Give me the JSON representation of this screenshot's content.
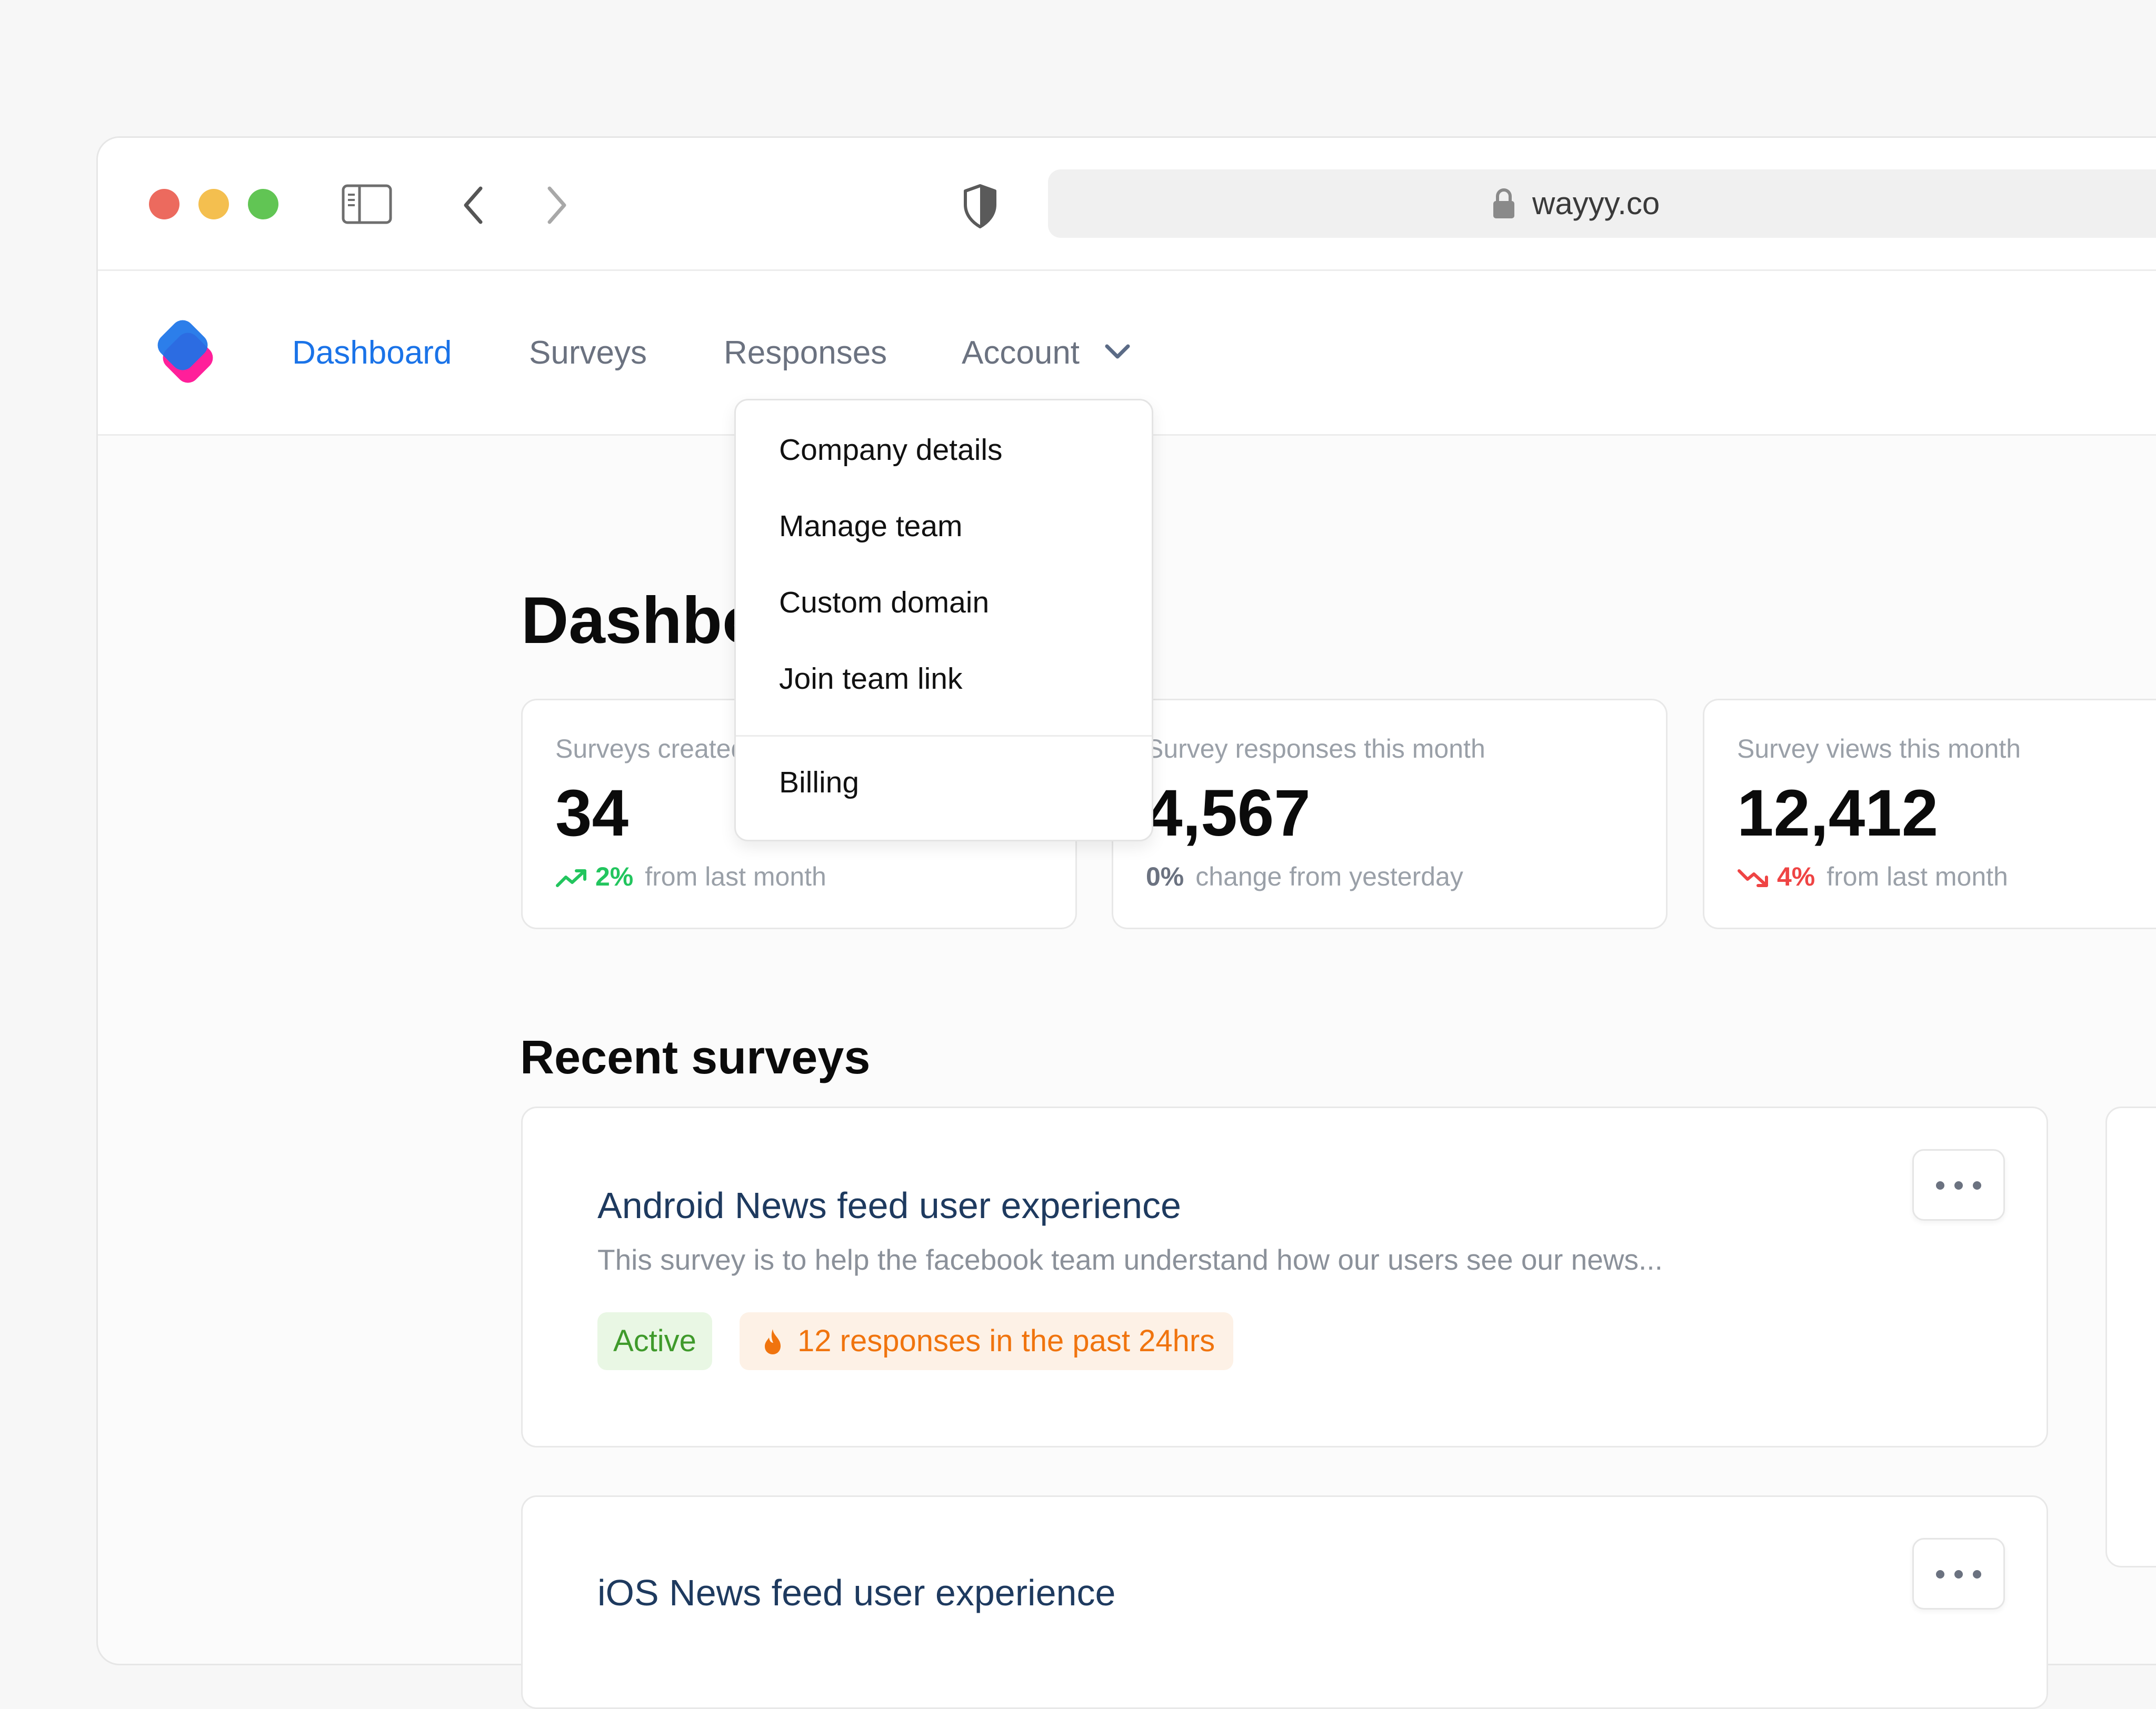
{
  "browser": {
    "url": "wayyy.co"
  },
  "nav": {
    "items": [
      {
        "label": "Dashboard",
        "active": true
      },
      {
        "label": "Surveys",
        "active": false
      },
      {
        "label": "Responses",
        "active": false
      },
      {
        "label": "Account",
        "active": false
      }
    ]
  },
  "account_menu": {
    "items": [
      "Company details",
      "Manage team",
      "Custom domain",
      "Join team link"
    ],
    "footer_item": "Billing"
  },
  "page": {
    "title": "Dashboard"
  },
  "stats": [
    {
      "label": "Surveys created this month",
      "value": "34",
      "delta": "2%",
      "delta_text": "from last month",
      "trend": "up"
    },
    {
      "label": "Survey responses this month",
      "value": "4,567",
      "delta": "0%",
      "delta_text": "change from yesterday",
      "trend": "flat"
    },
    {
      "label": "Survey views this month",
      "value": "12,412",
      "delta": "4%",
      "delta_text": "from last month",
      "trend": "down"
    }
  ],
  "recent": {
    "heading": "Recent surveys",
    "surveys": [
      {
        "title": "Android News feed user experience",
        "description": "This survey is to help the facebook team understand how our users see our news...",
        "status": "Active",
        "activity": "12 responses in the past 24hrs"
      },
      {
        "title": "iOS News feed user experience"
      }
    ]
  },
  "colors": {
    "accent": "#1a73e8",
    "positive": "#22c55e",
    "negative": "#ef4444",
    "warning": "#f0740e"
  }
}
